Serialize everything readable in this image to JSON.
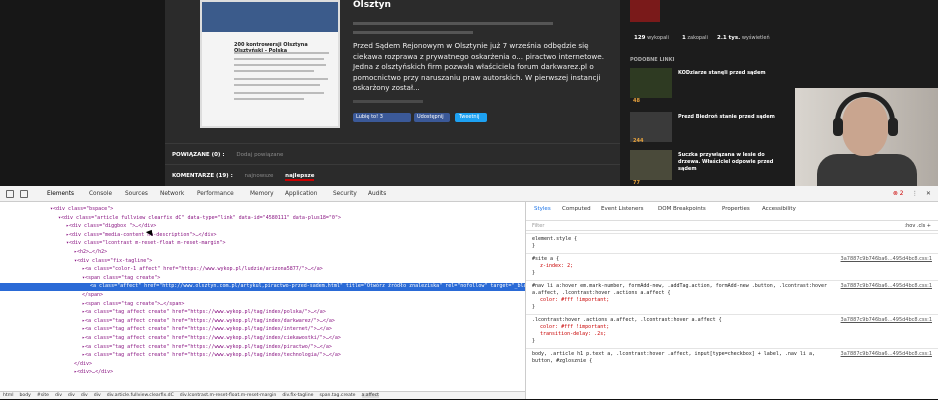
{
  "article": {
    "headline": "Olsztyn",
    "lead": "Przed Sądem Rejonowym w Olsztynie już 7 września odbędzie się ciekawa rozprawa z prywatnego oskarżenia o... piractwo internetowe. Jedna z olsztyńskich firm pozwała właściciela forum darkwarez.pl o pomocnictwo przy naruszaniu praw autorskich. W pierwszej instancji oskarżony został...",
    "thumb_heading": "200 kontrowersji Olsztyna Olsztyński - Polska",
    "like_button": "Lubię to! 3",
    "share_button": "Udostępnij",
    "tweet_button": "Tweetnij",
    "related_label": "POWIĄZANE (0) :",
    "related_link": "Dodaj powiązane",
    "comments_label": "KOMENTARZE (19) :",
    "sort_options": [
      "najnowsze",
      "najlepsze"
    ]
  },
  "sidebar": {
    "stats": [
      {
        "value": "129",
        "label": "wykopali"
      },
      {
        "value": "1",
        "label": "zakopali"
      },
      {
        "value": "2.1 tys.",
        "label": "wyświetleń"
      }
    ],
    "section_title": "PODOBNE LINKI",
    "items": [
      {
        "title": "KODziarze stanęli przed sądem",
        "score": "48"
      },
      {
        "title": "Prezd Biedroń stanie przed sądem",
        "score": "244"
      },
      {
        "title": "Suczka przywiązana w lesie do drzewa. Właściciel odpowie przed sądem",
        "score": "77"
      }
    ]
  },
  "devtools": {
    "tabs": [
      "Elements",
      "Console",
      "Sources",
      "Network",
      "Performance",
      "Memory",
      "Application",
      "Security",
      "Audits"
    ],
    "error_count": "2",
    "elements": [
      {
        "indent": 0,
        "html": "▾<div class=\"bspace\">"
      },
      {
        "indent": 1,
        "html": "▾<div class=\"article fullview clearfix dC\" data-type=\"link\" data-id=\"4580111\" data-plus18=\"0\">"
      },
      {
        "indent": 2,
        "html": "▸<div class=\"diggbox \">…</div>"
      },
      {
        "indent": 2,
        "html": "▸<div class=\"media-content no-description\">…</div>"
      },
      {
        "indent": 2,
        "html": "▾<div class=\"lcontrast m-reset-float m-reset-margin\">"
      },
      {
        "indent": 3,
        "html": "▸<h2>…</h2>"
      },
      {
        "indent": 3,
        "html": "▾<div class=\"fix-tagline\">"
      },
      {
        "indent": 4,
        "html": "▸<a class=\"color-1 affect\" href=\"https://www.wykop.pl/ludzie/arizona5877/\">…</a>"
      },
      {
        "indent": 4,
        "html": "▾<span class=\"tag create\">"
      },
      {
        "indent": 5,
        "html": "<a class=\"affect\" href=\"http://www.olsztyn.com.pl/artykul,piractwo-przed-sadem.html\" title=\"Otwórz źródło znaleziska\" rel=\"nofollow\" target=\"_blank\">olsztyn.com.pl</a> == $0",
        "selected": true
      },
      {
        "indent": 4,
        "html": "</span>"
      },
      {
        "indent": 4,
        "html": "▸<span class=\"tag create\">…</span>"
      },
      {
        "indent": 4,
        "html": "▸<a class=\"tag affect create\" href=\"https://www.wykop.pl/tag/index/polska/\">…</a>"
      },
      {
        "indent": 4,
        "html": "▸<a class=\"tag affect create\" href=\"https://www.wykop.pl/tag/index/darkwarez/\">…</a>"
      },
      {
        "indent": 4,
        "html": "▸<a class=\"tag affect create\" href=\"https://www.wykop.pl/tag/index/internet/\">…</a>"
      },
      {
        "indent": 4,
        "html": "▸<a class=\"tag affect create\" href=\"https://www.wykop.pl/tag/index/ciekawostki/\">…</a>"
      },
      {
        "indent": 4,
        "html": "▸<a class=\"tag affect create\" href=\"https://www.wykop.pl/tag/index/piractwo/\">…</a>"
      },
      {
        "indent": 4,
        "html": "▸<a class=\"tag affect create\" href=\"https://www.wykop.pl/tag/index/technologia/\">…</a>"
      },
      {
        "indent": 3,
        "html": "</div>"
      },
      {
        "indent": 3,
        "html": "▸<div>…</div>"
      }
    ],
    "breadcrumb": [
      "html",
      "body",
      "#site",
      "div",
      "div",
      "div",
      "div",
      "div.article.fullview.clearfix.dC",
      "div.lcontrast.m-reset-float.m-reset-margin",
      "div.fix-tagline",
      "span.tag.create",
      "a.affect"
    ],
    "styles_tabs": [
      "Styles",
      "Computed",
      "Event Listeners",
      "DOM Breakpoints",
      "Properties",
      "Accessibility"
    ],
    "filter_placeholder": "Filter",
    "hov_cls": ":hov .cls +",
    "rules": [
      {
        "selector": "element.style {",
        "lines": [
          "}"
        ],
        "source": ""
      },
      {
        "selector": "#site a {",
        "lines": [
          "z-index: 2;",
          "}"
        ],
        "source": "3a7887c9b746ba6…495d4bc8.css:1"
      },
      {
        "selector": "#nav li a:hover em.mark-number, formAdd-new, .addTag.action, formAdd-new .button, .lcontrast:hover a.affect, .lcontrast:hover .actions a.affect {",
        "lines": [
          "color: #fff !important;",
          "}"
        ],
        "source": "3a7887c9b746ba6…495d4bc8.css:1"
      },
      {
        "selector": ".lcontrast:hover .actions a.affect, .lcontrast:hover a.affect {",
        "lines": [
          "color: #fff !important;",
          "transition-delay: .2s;",
          "}"
        ],
        "source": "3a7887c9b746ba6…495d4bc8.css:1"
      },
      {
        "selector": "body, .article h1 p.text a, .lcontrast:hover .affect, input[type=checkbox] + label, .nav li a, button, #zglosznie {",
        "lines": [],
        "source": "3a7887c9b746ba6…495d4bc8.css:1"
      }
    ]
  }
}
